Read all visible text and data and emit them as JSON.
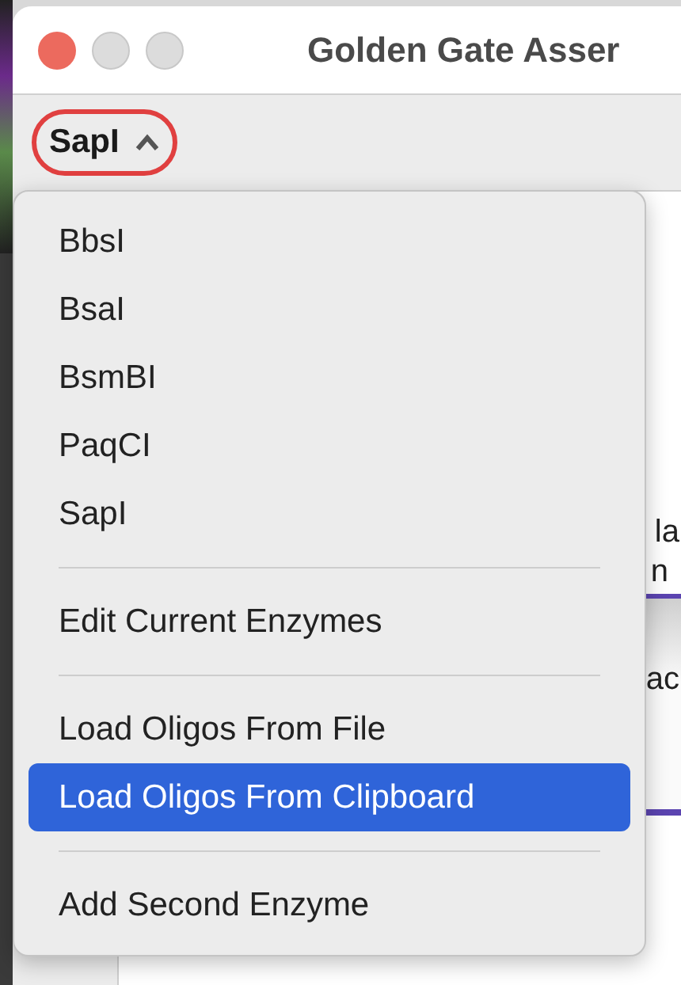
{
  "window": {
    "title": "Golden Gate Asser"
  },
  "toolbar": {
    "enzyme_popup": {
      "label": "SapI",
      "expanded": true,
      "circled": true
    }
  },
  "background": {
    "fragments": [
      "la",
      "n",
      "ac"
    ]
  },
  "menu": {
    "items": [
      {
        "kind": "item",
        "label": "BbsI",
        "selected": false
      },
      {
        "kind": "item",
        "label": "BsaI",
        "selected": false
      },
      {
        "kind": "item",
        "label": "BsmBI",
        "selected": false
      },
      {
        "kind": "item",
        "label": "PaqCI",
        "selected": false
      },
      {
        "kind": "item",
        "label": "SapI",
        "selected": false
      },
      {
        "kind": "separator"
      },
      {
        "kind": "item",
        "label": "Edit Current Enzymes",
        "selected": false
      },
      {
        "kind": "separator"
      },
      {
        "kind": "item",
        "label": "Load Oligos From File",
        "selected": false
      },
      {
        "kind": "item",
        "label": "Load Oligos From Clipboard",
        "selected": true
      },
      {
        "kind": "separator"
      },
      {
        "kind": "item",
        "label": "Add Second Enzyme",
        "selected": false
      }
    ]
  }
}
